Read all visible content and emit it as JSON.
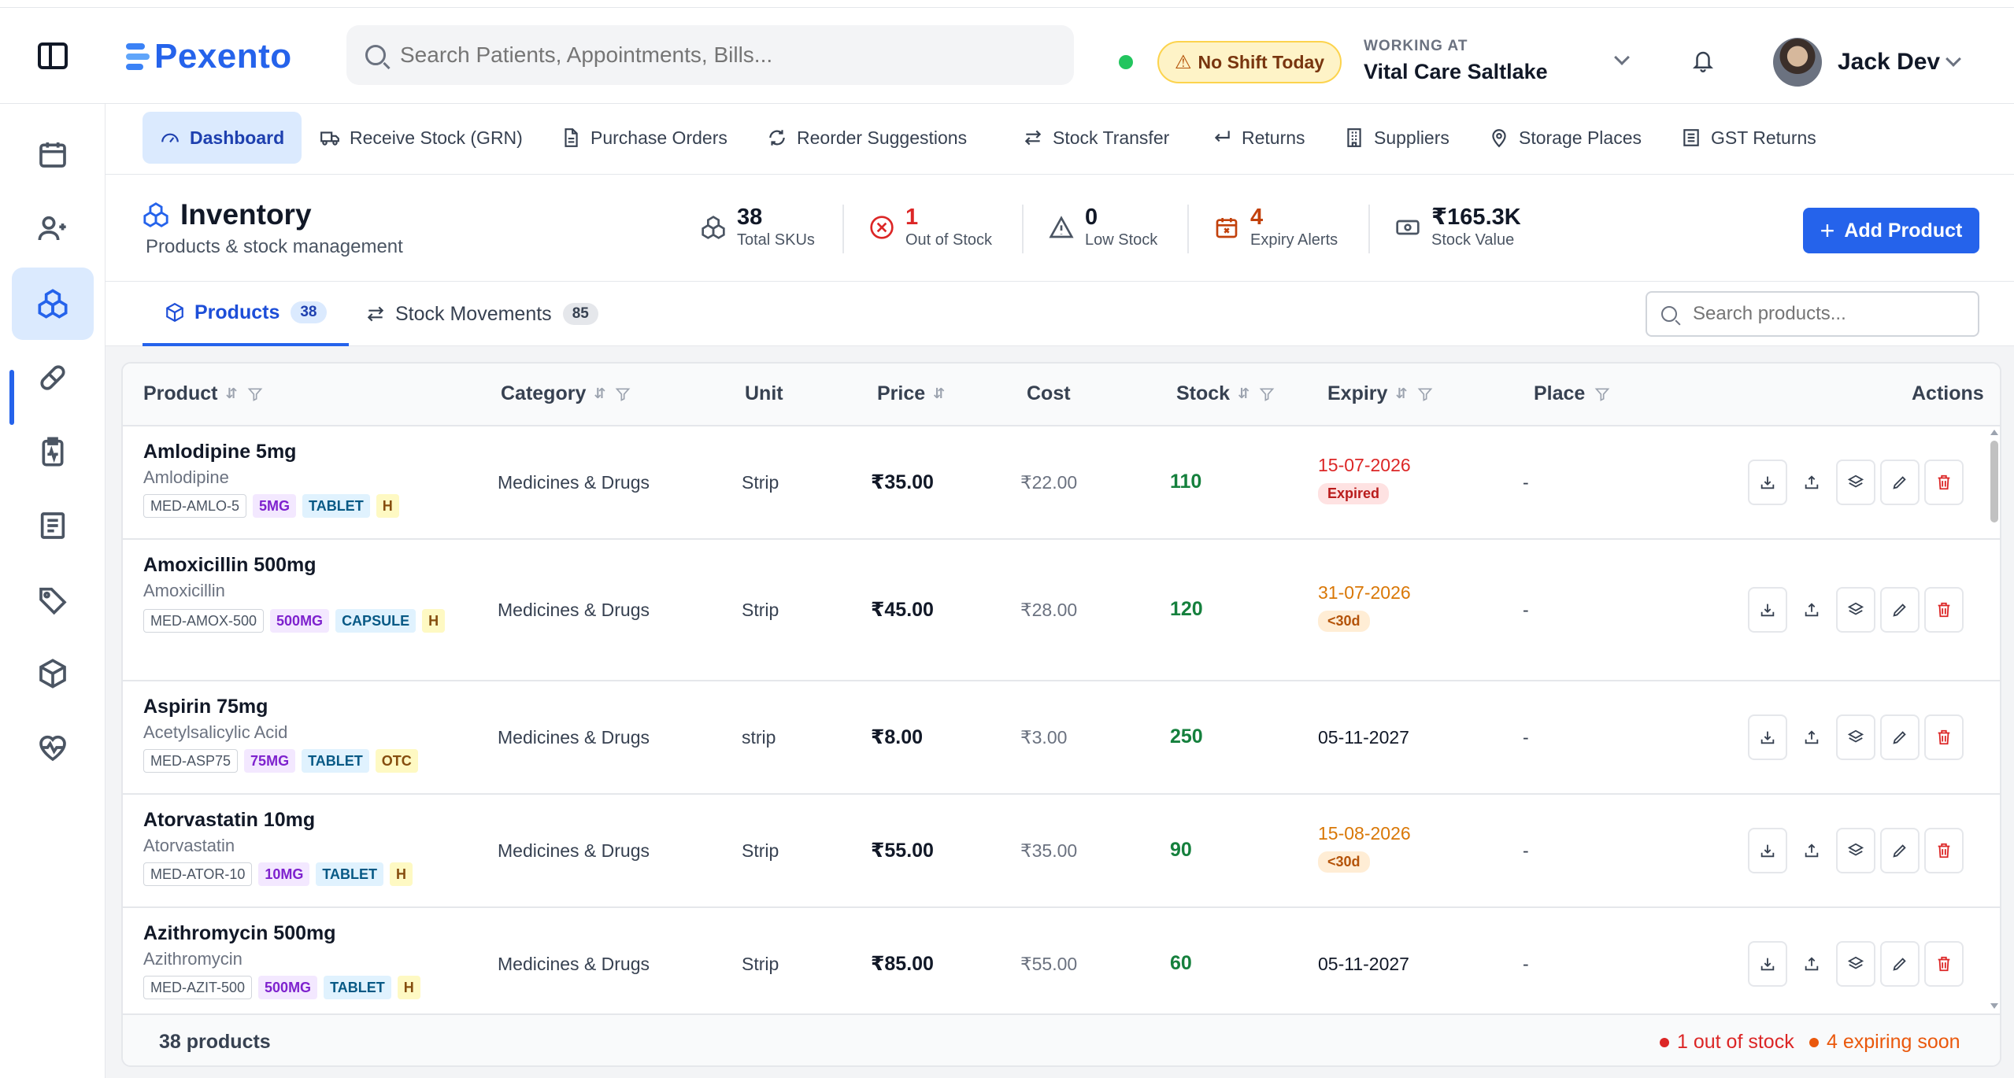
{
  "app": {
    "brand": "Pexento"
  },
  "header": {
    "search_placeholder": "Search Patients, Appointments, Bills...",
    "shift_badge": "No Shift Today",
    "working_label": "WORKING AT",
    "working_name": "Vital Care Saltlake",
    "user_name": "Jack Dev"
  },
  "rail": [
    "calendar-icon",
    "patients-icon",
    "inventory-icon",
    "pill-icon",
    "clipboard-icon",
    "billing-icon",
    "tag-icon",
    "box-icon",
    "heart-pulse-icon"
  ],
  "nav": {
    "items": [
      {
        "label": "Dashboard"
      },
      {
        "label": "Receive Stock (GRN)"
      },
      {
        "label": "Purchase Orders"
      },
      {
        "label": "Reorder Suggestions"
      },
      {
        "label": "Stock Transfer"
      },
      {
        "label": "Returns"
      },
      {
        "label": "Suppliers"
      },
      {
        "label": "Storage Places"
      },
      {
        "label": "GST Returns"
      }
    ]
  },
  "page": {
    "title": "Inventory",
    "subtitle": "Products & stock management",
    "add_button": "Add Product",
    "stats": [
      {
        "value": "38",
        "label": "Total SKUs",
        "color": "#111827"
      },
      {
        "value": "1",
        "label": "Out of Stock",
        "color": "#dc2626"
      },
      {
        "value": "0",
        "label": "Low Stock",
        "color": "#111827"
      },
      {
        "value": "4",
        "label": "Expiry Alerts",
        "color": "#c2410c"
      },
      {
        "value": "₹165.3K",
        "label": "Stock Value",
        "color": "#111827"
      }
    ]
  },
  "tabs": [
    {
      "label": "Products",
      "count": "38"
    },
    {
      "label": "Stock Movements",
      "count": "85"
    }
  ],
  "product_search_placeholder": "Search products...",
  "table": {
    "columns": {
      "product": "Product",
      "category": "Category",
      "unit": "Unit",
      "price": "Price",
      "cost": "Cost",
      "stock": "Stock",
      "expiry": "Expiry",
      "place": "Place",
      "actions": "Actions"
    },
    "rows": [
      {
        "name": "Amlodipine 5mg",
        "generic": "Amlodipine",
        "sku": "MED-AMLO-5",
        "strength": "5MG",
        "form": "TABLET",
        "schedule": "H",
        "category": "Medicines & Drugs",
        "unit": "Strip",
        "price": "₹35.00",
        "cost": "₹22.00",
        "stock": "110",
        "expiry": "15-07-2026",
        "expiry_badge": "Expired",
        "place": "-"
      },
      {
        "name": "Amoxicillin 500mg",
        "generic": "Amoxicillin",
        "sku": "MED-AMOX-500",
        "strength": "500MG",
        "form": "CAPSULE",
        "schedule": "H",
        "category": "Medicines & Drugs",
        "unit": "Strip",
        "price": "₹45.00",
        "cost": "₹28.00",
        "stock": "120",
        "expiry": "31-07-2026",
        "expiry_badge": "<30d",
        "place": "-"
      },
      {
        "name": "Aspirin 75mg",
        "generic": "Acetylsalicylic Acid",
        "sku": "MED-ASP75",
        "strength": "75MG",
        "form": "TABLET",
        "schedule": "OTC",
        "category": "Medicines & Drugs",
        "unit": "strip",
        "price": "₹8.00",
        "cost": "₹3.00",
        "stock": "250",
        "expiry": "05-11-2027",
        "expiry_badge": "",
        "place": "-"
      },
      {
        "name": "Atorvastatin 10mg",
        "generic": "Atorvastatin",
        "sku": "MED-ATOR-10",
        "strength": "10MG",
        "form": "TABLET",
        "schedule": "H",
        "category": "Medicines & Drugs",
        "unit": "Strip",
        "price": "₹55.00",
        "cost": "₹35.00",
        "stock": "90",
        "expiry": "15-08-2026",
        "expiry_badge": "<30d",
        "place": "-"
      },
      {
        "name": "Azithromycin 500mg",
        "generic": "Azithromycin",
        "sku": "MED-AZIT-500",
        "strength": "500MG",
        "form": "TABLET",
        "schedule": "H",
        "category": "Medicines & Drugs",
        "unit": "Strip",
        "price": "₹85.00",
        "cost": "₹55.00",
        "stock": "60",
        "expiry": "05-11-2027",
        "expiry_badge": "",
        "place": "-"
      }
    ],
    "footer": {
      "count": "38 products",
      "out_of_stock": "1 out of stock",
      "expiring": "4 expiring soon"
    }
  }
}
